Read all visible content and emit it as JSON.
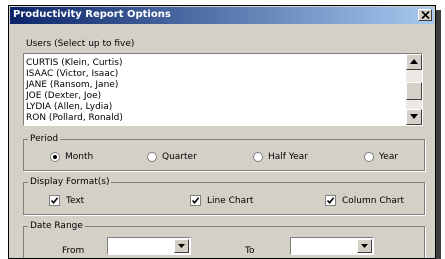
{
  "window": {
    "title": "Productivity Report Options",
    "close_symbol": "×"
  },
  "users": {
    "label": "Users (Select up to five)",
    "items": [
      "CURTIS (Klein, Curtis)",
      "ISAAC (Victor, Isaac)",
      "JANE (Ransom, Jane)",
      "JOE (Dexter, Joe)",
      "LYDIA (Allen, Lydia)",
      "RON (Pollard, Ronald)"
    ]
  },
  "period": {
    "label": "Period",
    "options": [
      "Month",
      "Quarter",
      "Half Year",
      "Year"
    ],
    "selected": "Month"
  },
  "display_format": {
    "label": "Display Format(s)",
    "options": [
      {
        "label": "Text",
        "checked": true
      },
      {
        "label": "Line Chart",
        "checked": true
      },
      {
        "label": "Column Chart",
        "checked": true
      }
    ]
  },
  "date_range": {
    "label": "Date Range",
    "from_label": "From",
    "to_label": "To",
    "from_value": "",
    "to_value": ""
  }
}
